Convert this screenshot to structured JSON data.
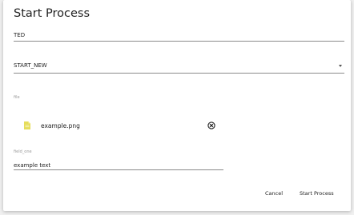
{
  "dialog": {
    "title": "Start Process",
    "name_field": {
      "value": "TED"
    },
    "process_select": {
      "selected": "START_NEW"
    },
    "file_section": {
      "caption": "file",
      "file_name": "example.png",
      "file_icon": "file-icon",
      "remove_icon": "close-circle-icon"
    },
    "field_one": {
      "caption": "field_one",
      "value": "example text"
    },
    "actions": {
      "cancel_label": "Cancel",
      "start_label": "Start Process"
    }
  },
  "colors": {
    "file_icon": "#e6dd5a",
    "underline": "#8a8a8a",
    "caption": "#9a9a9a"
  }
}
